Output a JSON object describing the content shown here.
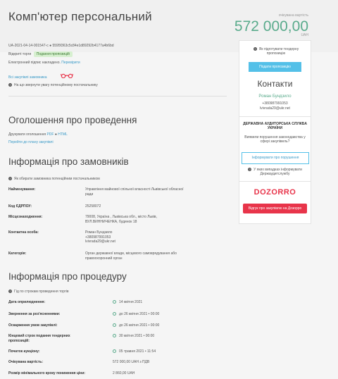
{
  "header": {
    "title": "Комп'ютер персональний",
    "price_label": "очікувана вартість",
    "price": "572 000,00",
    "currency": "UAH"
  },
  "tender": {
    "id": "UA-2021-04-14-001547-c ● 5595f363c5c84e1d89292b4177a4b6bd",
    "procedure": "Відкриті торги",
    "status": "Подання пропозицій",
    "signature_label": "Електронний підпис накладено.",
    "signature_link": "Перевірити",
    "all_purchases_link": "Всі закупівлі замовника",
    "note": "На що звернути увагу потенційному постачальнику"
  },
  "sidebar": {
    "prepare_hint": "Як підготувати тендерну пропозицію",
    "submit_button": "Подати пропозицію",
    "contacts_title": "Контакти",
    "contact_name": "Роман Бундзило",
    "contact_phone": "+380987991053",
    "contact_email": "lvivrada29@ukr.net",
    "audit_title": "ДЕРЖАВНА АУДИТОРСЬКА СЛУЖБА УКРАЇНИ",
    "audit_question": "Виявили порушення законодавства у сфері закупівель?",
    "report_button": "Інформувати про порушення",
    "audit_hint": "У яких випадках інформувати Держаудитслужбу",
    "dozorro_logo": "DOZORRO",
    "dozorro_button": "Відгук про закупівлю на Дозорро"
  },
  "announcement": {
    "title": "Оголошення про проведення",
    "print_label": "Друкувати оголошення",
    "print_pdf": "PDF",
    "print_html": "HTML",
    "plan_link": "Перейти до плану закупівлі"
  },
  "customer": {
    "title": "Інформація про замовників",
    "hint": "Як обирати замовника потенційним постачальником",
    "rows": [
      {
        "label": "Найменування:",
        "value": "Управління майнової спільної власності Львівської обласної ради"
      },
      {
        "label": "Код ЄДРПОУ:",
        "value": "25258072"
      },
      {
        "label": "Місцезнаходження:",
        "value": "79008, Україна , Львівська обл., місто Львів, ВУЛ.ВИННИЧЕНКА, будинок 18"
      },
      {
        "label": "Контактна особа:",
        "value": "Роман Бундзило\n+380987991053\nlvivrada29@ukr.net"
      },
      {
        "label": "Категорія:",
        "value": "Орган державної влади, місцевого самоврядування або правоохоронний орган"
      }
    ]
  },
  "procedure": {
    "title": "Інформація про процедуру",
    "hint": "Гід по строкам проведення торгів",
    "rows": [
      {
        "label": "Дата оприлюднення:",
        "value": "14 квітня 2021"
      },
      {
        "label": "Звернення за роз'ясненнями:",
        "value": "до  26 квітня 2021  •  00:00"
      },
      {
        "label": "Оскарження умов закупівлі:",
        "value": "до  26 квітня 2021  •  00:00"
      },
      {
        "label": "Кінцевий строк подання тендерних пропозицій:",
        "value": "30 квітня 2021  •  00:00"
      },
      {
        "label": "Початок аукціону:",
        "value": "05 травня 2021  •  11:54"
      },
      {
        "label": "Очікувана вартість:",
        "value": "572 000,00 UAH з ПДВ"
      },
      {
        "label": "Розмір мінімального кроку пониження ціни:",
        "value": "2 860,00 UAH"
      }
    ]
  },
  "colors": {
    "accent_green": "#5aab8c",
    "accent_blue": "#54c0e8",
    "accent_red": "#e8344a"
  }
}
